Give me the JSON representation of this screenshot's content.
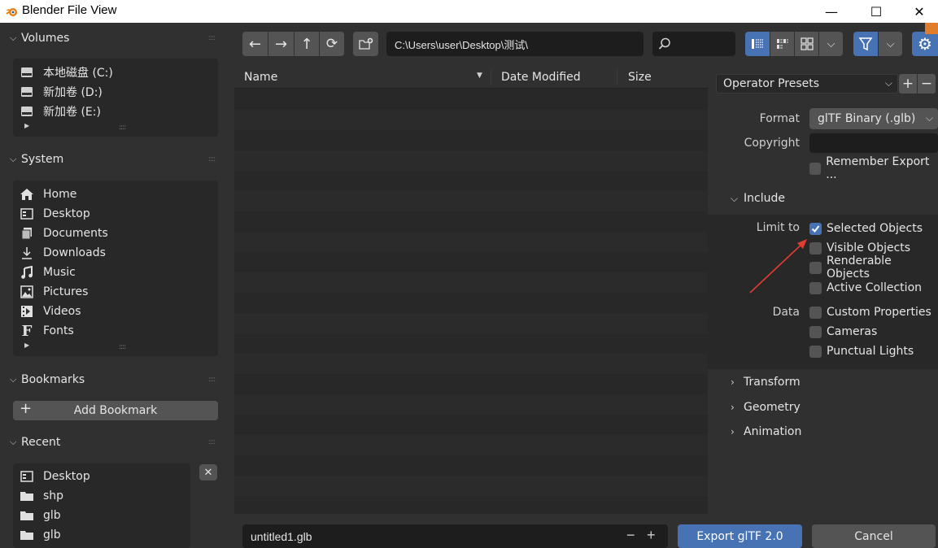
{
  "window": {
    "title": "Blender File View",
    "minimize": "—",
    "maximize": "☐",
    "close": "✕"
  },
  "volumes": {
    "heading": "Volumes",
    "items": [
      {
        "label": "本地磁盘 (C:)",
        "icon": "drive-icon"
      },
      {
        "label": "新加卷 (D:)",
        "icon": "drive-icon"
      },
      {
        "label": "新加卷 (E:)",
        "icon": "drive-icon"
      }
    ]
  },
  "system": {
    "heading": "System",
    "items": [
      {
        "label": "Home",
        "icon": "home-icon"
      },
      {
        "label": "Desktop",
        "icon": "desktop-icon"
      },
      {
        "label": "Documents",
        "icon": "documents-icon"
      },
      {
        "label": "Downloads",
        "icon": "download-icon"
      },
      {
        "label": "Music",
        "icon": "music-icon"
      },
      {
        "label": "Pictures",
        "icon": "image-icon"
      },
      {
        "label": "Videos",
        "icon": "video-icon"
      },
      {
        "label": "Fonts",
        "icon": "font-icon"
      }
    ]
  },
  "bookmarks": {
    "heading": "Bookmarks",
    "add_label": "Add Bookmark"
  },
  "recent": {
    "heading": "Recent",
    "items": [
      {
        "label": "Desktop",
        "icon": "desktop-icon"
      },
      {
        "label": "shp",
        "icon": "folder-icon"
      },
      {
        "label": "glb",
        "icon": "folder-icon"
      },
      {
        "label": "glb",
        "icon": "folder-icon"
      }
    ]
  },
  "toolbar": {
    "path": "C:\\Users\\user\\Desktop\\测试\\"
  },
  "filelist": {
    "col_name": "Name",
    "col_date": "Date Modified",
    "col_size": "Size"
  },
  "settings": {
    "preset_label": "Operator Presets",
    "format_label": "Format",
    "format_value": "glTF Binary (.glb)",
    "copyright_label": "Copyright",
    "copyright_value": "",
    "remember_label": "Remember Export ...",
    "include_heading": "Include",
    "limit_to_label": "Limit to",
    "limit_options": [
      {
        "label": "Selected Objects",
        "checked": true
      },
      {
        "label": "Visible Objects",
        "checked": false
      },
      {
        "label": "Renderable Objects",
        "checked": false
      },
      {
        "label": "Active Collection",
        "checked": false
      }
    ],
    "data_label": "Data",
    "data_options": [
      {
        "label": "Custom Properties",
        "checked": false
      },
      {
        "label": "Cameras",
        "checked": false
      },
      {
        "label": "Punctual Lights",
        "checked": false
      }
    ],
    "sections": [
      "Transform",
      "Geometry",
      "Animation"
    ]
  },
  "footer": {
    "filename": "untitled1.glb",
    "export_label": "Export glTF 2.0",
    "cancel_label": "Cancel"
  },
  "colors": {
    "accent": "#4772b3",
    "background": "#303030",
    "field": "#1d1d1d",
    "annotation_arrow": "#e03c31"
  }
}
